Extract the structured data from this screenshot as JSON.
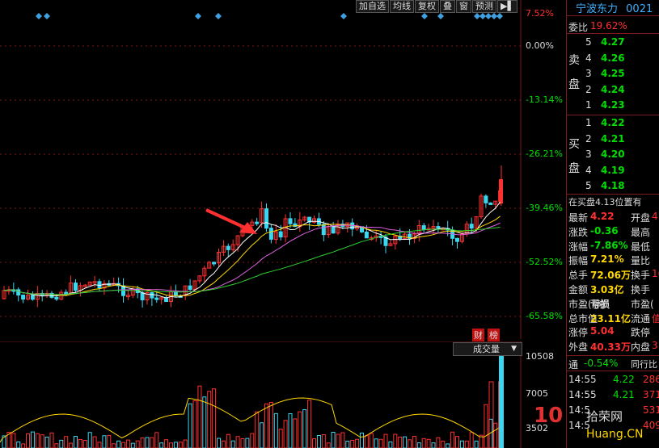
{
  "toolbar": {
    "add_favorite": "加自选",
    "avg_line": "均线",
    "rehab": "复权",
    "overlay": "叠",
    "window": "窗",
    "forecast": "预测",
    "export_icon": "▶▌"
  },
  "pct_axis": [
    "7.52%",
    "0.00%",
    "-13.14%",
    "-26.21%",
    "-39.46%",
    "-52.52%",
    "-65.58%"
  ],
  "vol_axis": [
    "10508",
    "7005",
    "3502"
  ],
  "stock": {
    "name": "宁波东力",
    "code": "0021"
  },
  "weibi": {
    "label": "委比",
    "value": "19.62%"
  },
  "sell": {
    "title": "卖盘",
    "levels": [
      {
        "n": "5",
        "p": "4.27"
      },
      {
        "n": "4",
        "p": "4.26"
      },
      {
        "n": "3",
        "p": "4.25"
      },
      {
        "n": "2",
        "p": "4.24"
      },
      {
        "n": "1",
        "p": "4.23"
      }
    ]
  },
  "buy": {
    "title": "买盘",
    "levels": [
      {
        "n": "1",
        "p": "4.22"
      },
      {
        "n": "2",
        "p": "4.21"
      },
      {
        "n": "3",
        "p": "4.20"
      },
      {
        "n": "4",
        "p": "4.19"
      },
      {
        "n": "5",
        "p": "4.18"
      }
    ]
  },
  "note": "在买盘4.13位置有",
  "stats": [
    {
      "l1": "最新",
      "v1": "4.22",
      "c1": "red",
      "l2": "开盘",
      "v2": "4"
    },
    {
      "l1": "涨跌",
      "v1": "-0.36",
      "c1": "green",
      "l2": "最高",
      "v2": ""
    },
    {
      "l1": "涨幅",
      "v1": "-7.86%",
      "c1": "green",
      "l2": "最低",
      "v2": ""
    },
    {
      "l1": "振幅",
      "v1": "7.21%",
      "c1": "yellow",
      "l2": "量比",
      "v2": ""
    },
    {
      "l1": "总手",
      "v1": "72.06万",
      "c1": "yellow",
      "l2": "换手",
      "v2": "16"
    },
    {
      "l1": "金额",
      "v1": "3.03亿",
      "c1": "yellow",
      "l2": "换手",
      "v2": ""
    },
    {
      "l1": "市盈(静)",
      "v1": "亏损",
      "c1": "white",
      "l2": "市盈(",
      "v2": ""
    },
    {
      "l1": "总市值",
      "v1": "23.11亿",
      "c1": "yellow",
      "l2": "流通",
      "v2": "值"
    },
    {
      "l1": "涨停",
      "v1": "5.04",
      "c1": "red",
      "l2": "跌停",
      "v2": ""
    },
    {
      "l1": "外盘",
      "v1": "40.33万",
      "c1": "red",
      "l2": "内盘",
      "v2": "31"
    }
  ],
  "tong": {
    "label": "通",
    "value": "-0.54%",
    "right": "同行比"
  },
  "ticks": [
    {
      "t": "14:55",
      "p": "4.22",
      "v": "286"
    },
    {
      "t": "14:55",
      "p": "4.21",
      "v": "371"
    },
    {
      "t": "14:5",
      "p": "",
      "v": "531"
    },
    {
      "t": "14:5",
      "p": "",
      "v": "409"
    }
  ],
  "vol_tag": "成交量",
  "cai": "财",
  "bang": "榜",
  "watermark": {
    "big": "10",
    "a": "拾荣网",
    "b": "Huang.CN"
  },
  "chart_data": {
    "type": "candlestick",
    "y_axis_ticks": [
      "7.52%",
      "0.00%",
      "-13.14%",
      "-26.21%",
      "-39.46%",
      "-52.52%",
      "-65.58%"
    ],
    "volume_axis_ticks": [
      "10508",
      "7005",
      "3502"
    ],
    "moving_averages": 4
  }
}
